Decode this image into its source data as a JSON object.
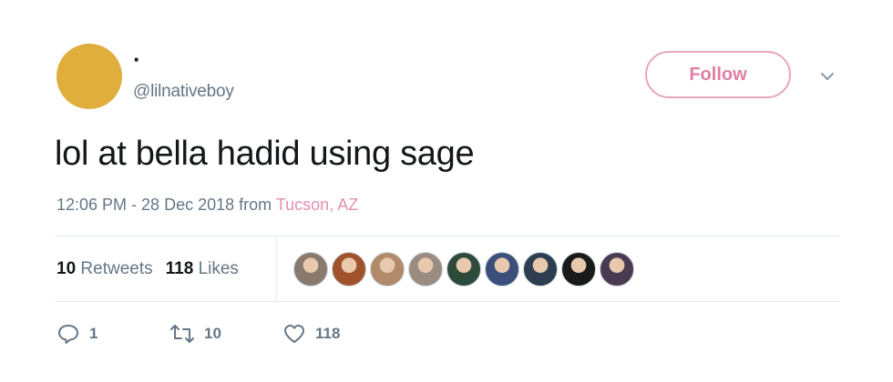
{
  "tweet": {
    "display_name": "·",
    "handle": "@lilnativeboy",
    "text": "lol at bella hadid using sage",
    "time": "12:06 PM - 28 Dec 2018",
    "from_label": "from",
    "location": "Tucson, AZ"
  },
  "follow_button": {
    "label": "Follow"
  },
  "stats": {
    "retweets_count": "10",
    "retweets_label": "Retweets",
    "likes_count": "118",
    "likes_label": "Likes"
  },
  "actions": {
    "reply_count": "1",
    "retweet_count": "10",
    "like_count": "118"
  },
  "icons": {
    "caret": "chevron-down-icon",
    "reply": "reply-icon",
    "retweet": "retweet-icon",
    "like": "heart-icon"
  },
  "colors": {
    "avatar": "#e0ae3c",
    "follow_accent": "#df7fa3",
    "location_link": "#e48fb0",
    "muted": "#657786",
    "liker_avatars": [
      "#8a7a6e",
      "#a0522d",
      "#b08a6a",
      "#9a8c80",
      "#2e4a3a",
      "#3a4f7a",
      "#2c3e50",
      "#1a1a1a",
      "#4a3b52"
    ]
  }
}
